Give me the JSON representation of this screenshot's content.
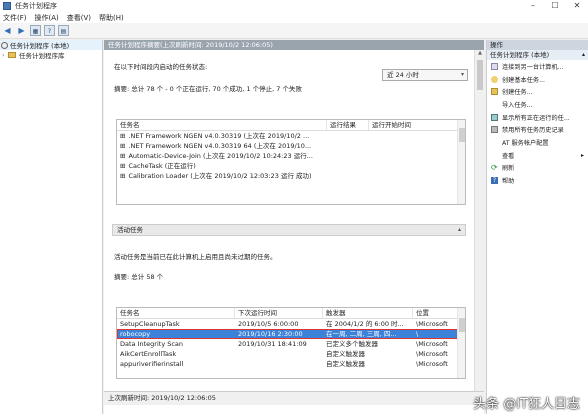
{
  "window": {
    "title": "任务计划程序"
  },
  "menu": [
    "文件(F)",
    "操作(A)",
    "查看(V)",
    "帮助(H)"
  ],
  "tree": {
    "root": "任务计划程序 (本地)",
    "child": "任务计划程序库"
  },
  "main": {
    "header": "任务计划程序摘要(上次刷新时间: 2019/10/2 12:06:05)",
    "status_label": "在以下时间段内启动的任务状态:",
    "period": "近 24 小时",
    "summary": "摘要: 总计 78 个 - 0 个正在运行, 70 个成功, 1 个停止, 7 个失败",
    "status_grid": {
      "columns": [
        "任务名",
        "运行结果",
        "运行开始时间"
      ],
      "rows": [
        ".NET Framework NGEN v4.0.30319 (上次在 2019/10/2 ...",
        ".NET Framework NGEN v4.0.30319 64 (上次在 2019/10...",
        "Automatic-Device-Join (上次在 2019/10/2 10:24:23 运行...",
        "CacheTask (正在运行)",
        "Calibration Loader (上次在 2019/10/2 12:03:23 运行 成功)"
      ]
    },
    "active_bar": "活动任务",
    "active_desc": "活动任务是当前已在此计算机上启用且尚未过期的任务。",
    "active_summary": "摘要: 总计 58 个",
    "active_grid": {
      "columns": [
        "任务名",
        "下次运行时间",
        "触发器",
        "位置"
      ],
      "rows": [
        [
          "SetupCleanupTask",
          "2019/10/5 6:00:00",
          "在 2004/1/2 的 6:00 时...",
          "\\Microsoft"
        ],
        [
          "robocopy",
          "2019/10/16 2:30:00",
          "在一周, 二周, 三周, 四...",
          "\\"
        ],
        [
          "Data Integrity Scan",
          "2019/10/31 18:41:09",
          "已定义多个触发器",
          "\\Microsoft"
        ],
        [
          "AikCertEnrollTask",
          "",
          "自定义触发器",
          "\\Microsoft"
        ],
        [
          "appuriverifierinstall",
          "",
          "自定义触发器",
          "\\Microsoft"
        ]
      ]
    },
    "status_bar": "上次刷新时间: 2019/10/2 12:06:05"
  },
  "actions": {
    "header": "操作",
    "subheader": "任务计划程序 (本地)",
    "items": [
      "连接到另一台计算机...",
      "创建基本任务...",
      "创建任务...",
      "导入任务...",
      "显示所有正在运行的任...",
      "禁用所有任务历史记录",
      "AT 服务帐户配置",
      "查看",
      "刷新",
      "帮助"
    ]
  },
  "watermark": "头条 @IT狂人日志"
}
